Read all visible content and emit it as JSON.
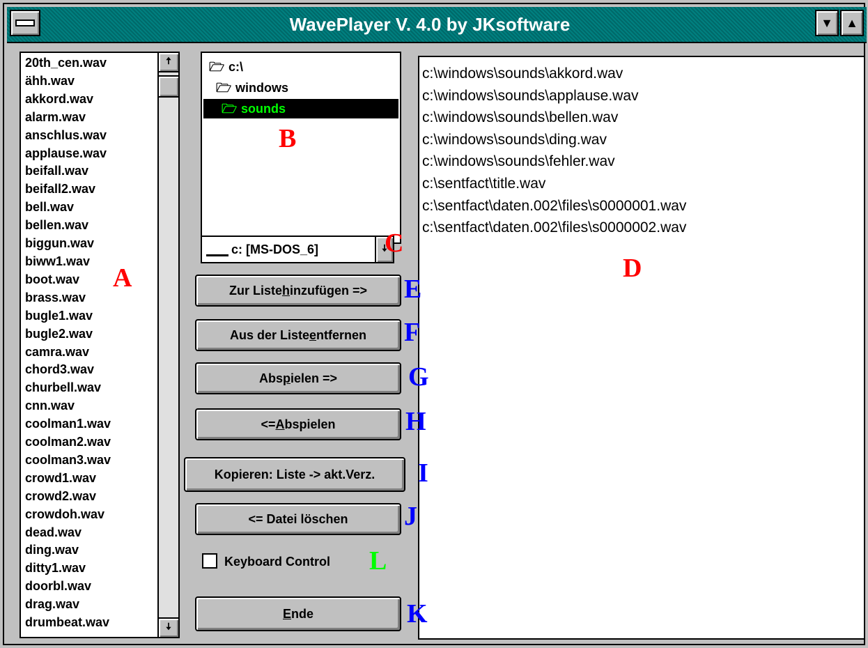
{
  "window": {
    "title": "WavePlayer V. 4.0 by JKsoftware",
    "minimize_glyph": "▼",
    "maximize_glyph": "▲"
  },
  "file_list": {
    "items": [
      "20th_cen.wav",
      "ähh.wav",
      "akkord.wav",
      "alarm.wav",
      "anschlus.wav",
      "applause.wav",
      "beifall.wav",
      "beifall2.wav",
      "bell.wav",
      "bellen.wav",
      "biggun.wav",
      "biww1.wav",
      "boot.wav",
      "brass.wav",
      "bugle1.wav",
      "bugle2.wav",
      "camra.wav",
      "chord3.wav",
      "churbell.wav",
      "cnn.wav",
      "coolman1.wav",
      "coolman2.wav",
      "coolman3.wav",
      "crowd1.wav",
      "crowd2.wav",
      "crowdoh.wav",
      "dead.wav",
      "ding.wav",
      "ditty1.wav",
      "doorbl.wav",
      "drag.wav",
      "drumbeat.wav"
    ],
    "scroll_up_glyph": "🠅",
    "scroll_down_glyph": "🠇"
  },
  "dir_tree": {
    "items": [
      {
        "label": "c:\\",
        "icon": "open-folder-icon",
        "glyph": "🗁"
      },
      {
        "label": "windows",
        "icon": "open-folder-icon",
        "glyph": "🗁"
      },
      {
        "label": "sounds",
        "icon": "open-folder-icon",
        "glyph": "🗁",
        "selected": true
      }
    ]
  },
  "drive_select": {
    "value": "c: [MS-DOS_6]",
    "icon": "drive-icon",
    "arrow_glyph": "🠇"
  },
  "buttons": {
    "add_pre": "Zur Liste ",
    "add_acc": "h",
    "add_post": "inzufügen =>",
    "remove_pre": "Aus der Liste ",
    "remove_acc": "e",
    "remove_post": "ntfernen",
    "play_right_pre": "Abs",
    "play_right_acc": "p",
    "play_right_post": "ielen =>",
    "play_left_pre": "<= ",
    "play_left_acc": "A",
    "play_left_post": "bspielen",
    "copy": "Kopieren: Liste -> akt.Verz.",
    "delete": "<= Datei löschen",
    "exit_acc": "E",
    "exit_post": "nde"
  },
  "keyboard_control": {
    "label": "Keyboard Control",
    "checked": false
  },
  "playlist": {
    "items": [
      "c:\\windows\\sounds\\akkord.wav",
      "c:\\windows\\sounds\\applause.wav",
      "c:\\windows\\sounds\\bellen.wav",
      "c:\\windows\\sounds\\ding.wav",
      "c:\\windows\\sounds\\fehler.wav",
      "c:\\sentfact\\title.wav",
      "c:\\sentfact\\daten.002\\files\\s0000001.wav",
      "c:\\sentfact\\daten.002\\files\\s0000002.wav"
    ]
  },
  "annotations": {
    "A": "A",
    "B": "B",
    "C": "C",
    "D": "D",
    "E": "E",
    "F": "F",
    "G": "G",
    "H": "H",
    "I": "I",
    "J": "J",
    "K": "K",
    "L": "L"
  },
  "colors": {
    "titlebar": "#008080",
    "window_bg": "#c0c0c0",
    "selection_bg": "#000000",
    "selection_text": "#00ff00",
    "annotation_red": "#ff0000",
    "annotation_blue": "#0000ff",
    "annotation_green": "#00ff00"
  }
}
